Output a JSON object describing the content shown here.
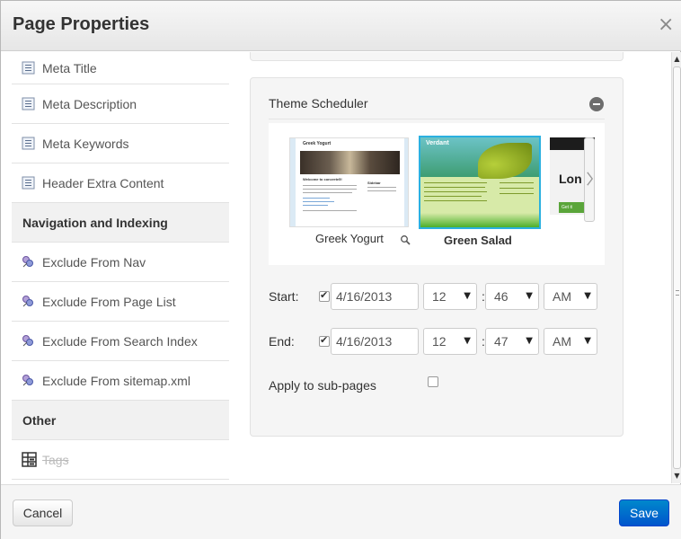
{
  "dialog": {
    "title": "Page Properties",
    "close_symbol": "×"
  },
  "sidebar": {
    "items_top": [
      {
        "label": "Meta Title",
        "icon": "document-text-icon"
      },
      {
        "label": "Meta Description",
        "icon": "document-text-icon"
      },
      {
        "label": "Meta Keywords",
        "icon": "document-text-icon"
      },
      {
        "label": "Header Extra Content",
        "icon": "document-text-icon"
      }
    ],
    "section_nav": "Navigation and Indexing",
    "items_nav": [
      {
        "label": "Exclude From Nav",
        "icon": "exclude-icon"
      },
      {
        "label": "Exclude From Page List",
        "icon": "exclude-icon"
      },
      {
        "label": "Exclude From Search Index",
        "icon": "exclude-icon"
      },
      {
        "label": "Exclude From sitemap.xml",
        "icon": "exclude-icon"
      }
    ],
    "section_other": "Other",
    "items_other": [
      {
        "label": "Tags",
        "icon": "tags-grid-icon",
        "disabled": true
      }
    ]
  },
  "theme_scheduler": {
    "title": "Theme Scheduler",
    "themes": [
      {
        "name": "Greek Yogurt",
        "selected": false,
        "thumb_heading": "Greek Yogurt",
        "thumb_welcome": "Welcome to concrete5!",
        "thumb_sidebar": "Sidebar"
      },
      {
        "name": "Green Salad",
        "selected": true,
        "thumb_logo": "Verdant"
      },
      {
        "name": "",
        "selected": false,
        "thumb_text": "Lon",
        "thumb_button": "Get it"
      }
    ],
    "start": {
      "label": "Start:",
      "checked": true,
      "date": "4/16/2013",
      "hour": "12",
      "minute": "46",
      "ampm": "AM",
      "colon": ":"
    },
    "end": {
      "label": "End:",
      "checked": true,
      "date": "4/16/2013",
      "hour": "12",
      "minute": "47",
      "ampm": "AM",
      "colon": ":"
    },
    "apply_sub_pages": {
      "label": "Apply to sub-pages",
      "checked": false
    }
  },
  "footer": {
    "cancel_label": "Cancel",
    "save_label": "Save"
  },
  "colors": {
    "primary_button": "#0066cc",
    "selected_theme_border": "#2bb0e0",
    "section_header_bg": "#f1f1f1"
  }
}
